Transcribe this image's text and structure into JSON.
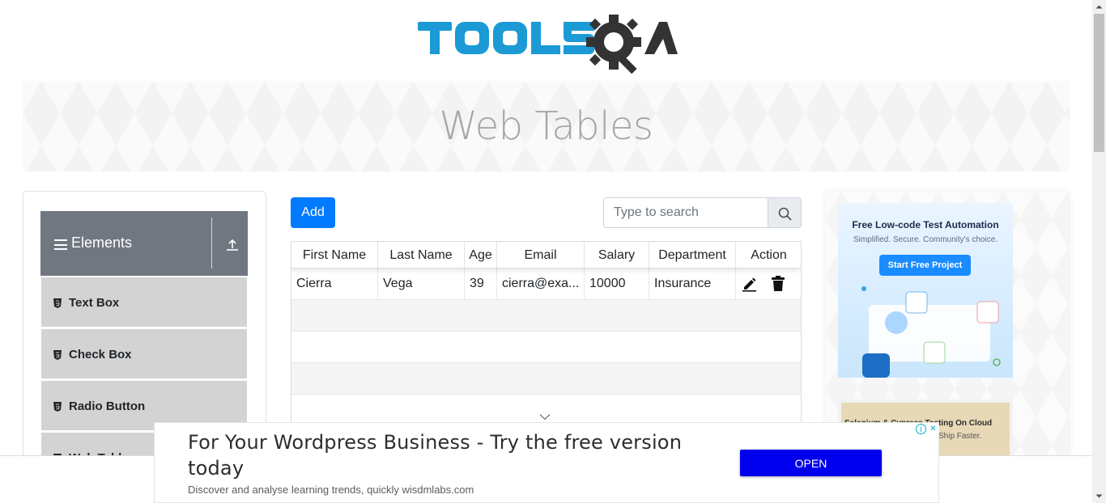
{
  "header": {
    "logo_text": "TOOLSQA"
  },
  "banner": {
    "title": "Web Tables"
  },
  "sidebar": {
    "group_title": "Elements",
    "items": [
      {
        "label": "Text Box"
      },
      {
        "label": "Check Box"
      },
      {
        "label": "Radio Button"
      },
      {
        "label": "Web Tables"
      }
    ]
  },
  "toolbar": {
    "add_label": "Add",
    "search_placeholder": "Type to search"
  },
  "table": {
    "columns": [
      "First Name",
      "Last Name",
      "Age",
      "Email",
      "Salary",
      "Department",
      "Action"
    ],
    "rows": [
      {
        "first_name": "Cierra",
        "last_name": "Vega",
        "age": "39",
        "email": "cierra@exa...",
        "salary": "10000",
        "department": "Insurance"
      }
    ]
  },
  "right_ad": {
    "ad1_title": "Free Low-code Test Automation",
    "ad1_subtitle": "Simplified. Secure. Community's choice.",
    "ad1_cta": "Start Free Project",
    "ad2_title": "Selenium & Cypress Testing On Cloud",
    "ad2_subtitle": "Ship Faster."
  },
  "bottom_ad": {
    "headline": "For Your Wordpress Business - Try the free version today",
    "description": "Discover and analyse learning trends, quickly wisdmlabs.com",
    "button_label": "OPEN"
  },
  "colors": {
    "primary": "#007bff",
    "logo_blue": "#1b9ad6",
    "logo_dark": "#333333",
    "sidebar_header": "#707780",
    "sidebar_item": "#d3d3d3",
    "ad_button": "#0000ee"
  }
}
